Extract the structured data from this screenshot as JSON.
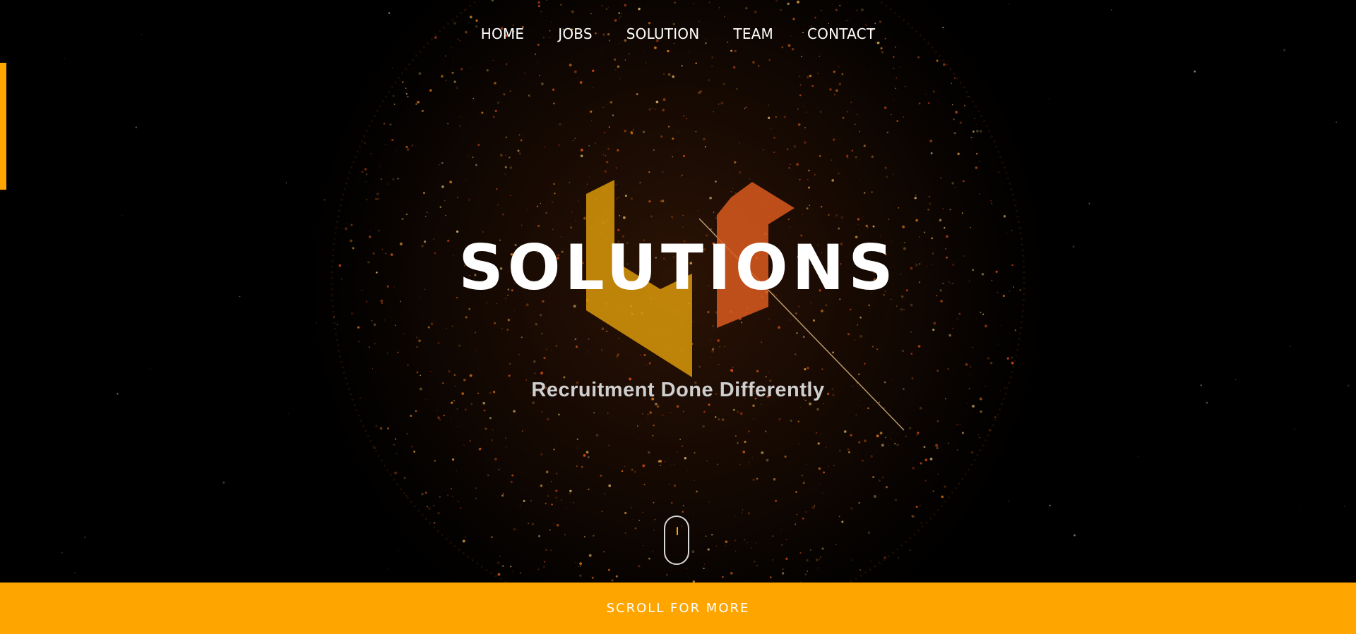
{
  "nav": {
    "items": [
      {
        "label": "HOME"
      },
      {
        "label": "JOBS"
      },
      {
        "label": "SOLUTION"
      },
      {
        "label": "TEAM"
      },
      {
        "label": "CONTACT"
      }
    ]
  },
  "hero": {
    "brand": "SOLUTIONS",
    "tagline": "Recruitment Done Differently"
  },
  "cta": {
    "label": "SCROLL FOR MORE"
  },
  "colors": {
    "accent": "#ffa500",
    "logo_left": "#d4940a",
    "logo_right": "#d95a1e",
    "background": "#000000",
    "text": "#ffffff"
  },
  "icons": {
    "scroll": "mouse-scroll-icon",
    "logo": "brand-logo-mark"
  }
}
